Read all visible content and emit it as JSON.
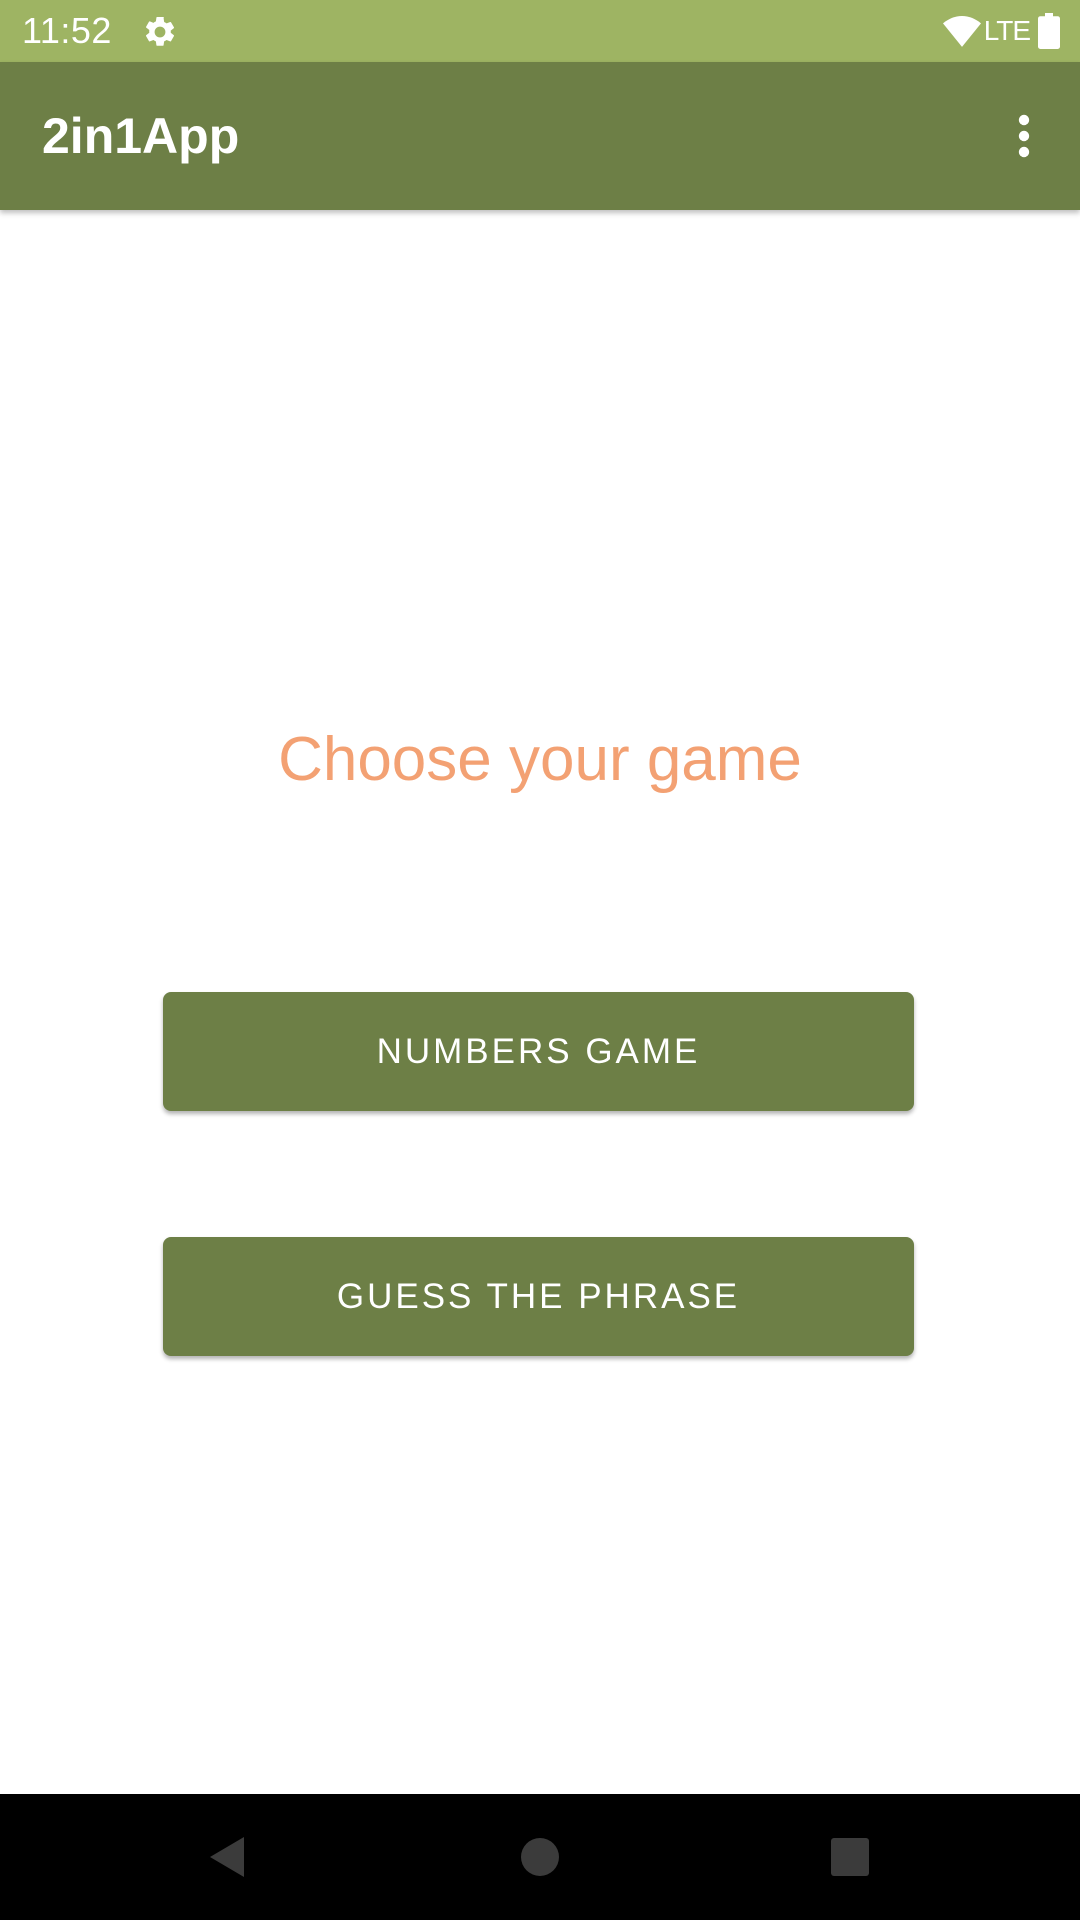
{
  "status_bar": {
    "time": "11:52",
    "network": "LTE",
    "icons": [
      "gear-icon",
      "wifi-icon",
      "battery-icon"
    ],
    "color": "#9eb463"
  },
  "app_bar": {
    "title": "2in1App",
    "menu_icon": "more-vert-icon",
    "color": "#6d7f46"
  },
  "main": {
    "headline": "Choose your game",
    "headline_color": "#f3a173",
    "buttons": [
      {
        "label": "NUMBERS GAME"
      },
      {
        "label": "GUESS THE PHRASE"
      }
    ],
    "button_color": "#6d7f46"
  },
  "nav_bar": {
    "icons": [
      "back-icon",
      "home-icon",
      "recents-icon"
    ]
  }
}
